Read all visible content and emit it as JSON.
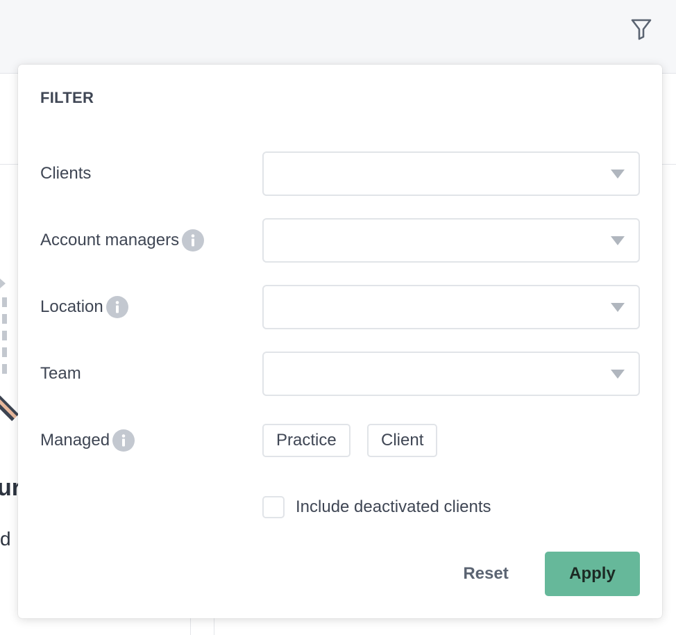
{
  "header": {
    "filter_icon": "filter-funnel-icon"
  },
  "background": {
    "heading_fragment": "ur",
    "text_fragment": "d"
  },
  "filter_panel": {
    "title": "FILTER",
    "fields": [
      {
        "label": "Clients",
        "has_info": false,
        "value": ""
      },
      {
        "label": "Account managers",
        "has_info": true,
        "value": ""
      },
      {
        "label": "Location",
        "has_info": true,
        "value": ""
      },
      {
        "label": "Team",
        "has_info": false,
        "value": ""
      }
    ],
    "managed": {
      "label": "Managed",
      "options": [
        "Practice",
        "Client"
      ]
    },
    "include_deactivated": {
      "label": "Include deactivated clients",
      "checked": false
    },
    "reset_label": "Reset",
    "apply_label": "Apply"
  },
  "colors": {
    "accent": "#66b89a",
    "text": "#3f4654",
    "border": "#e1e4e8",
    "info_icon": "#c3c8d0"
  }
}
